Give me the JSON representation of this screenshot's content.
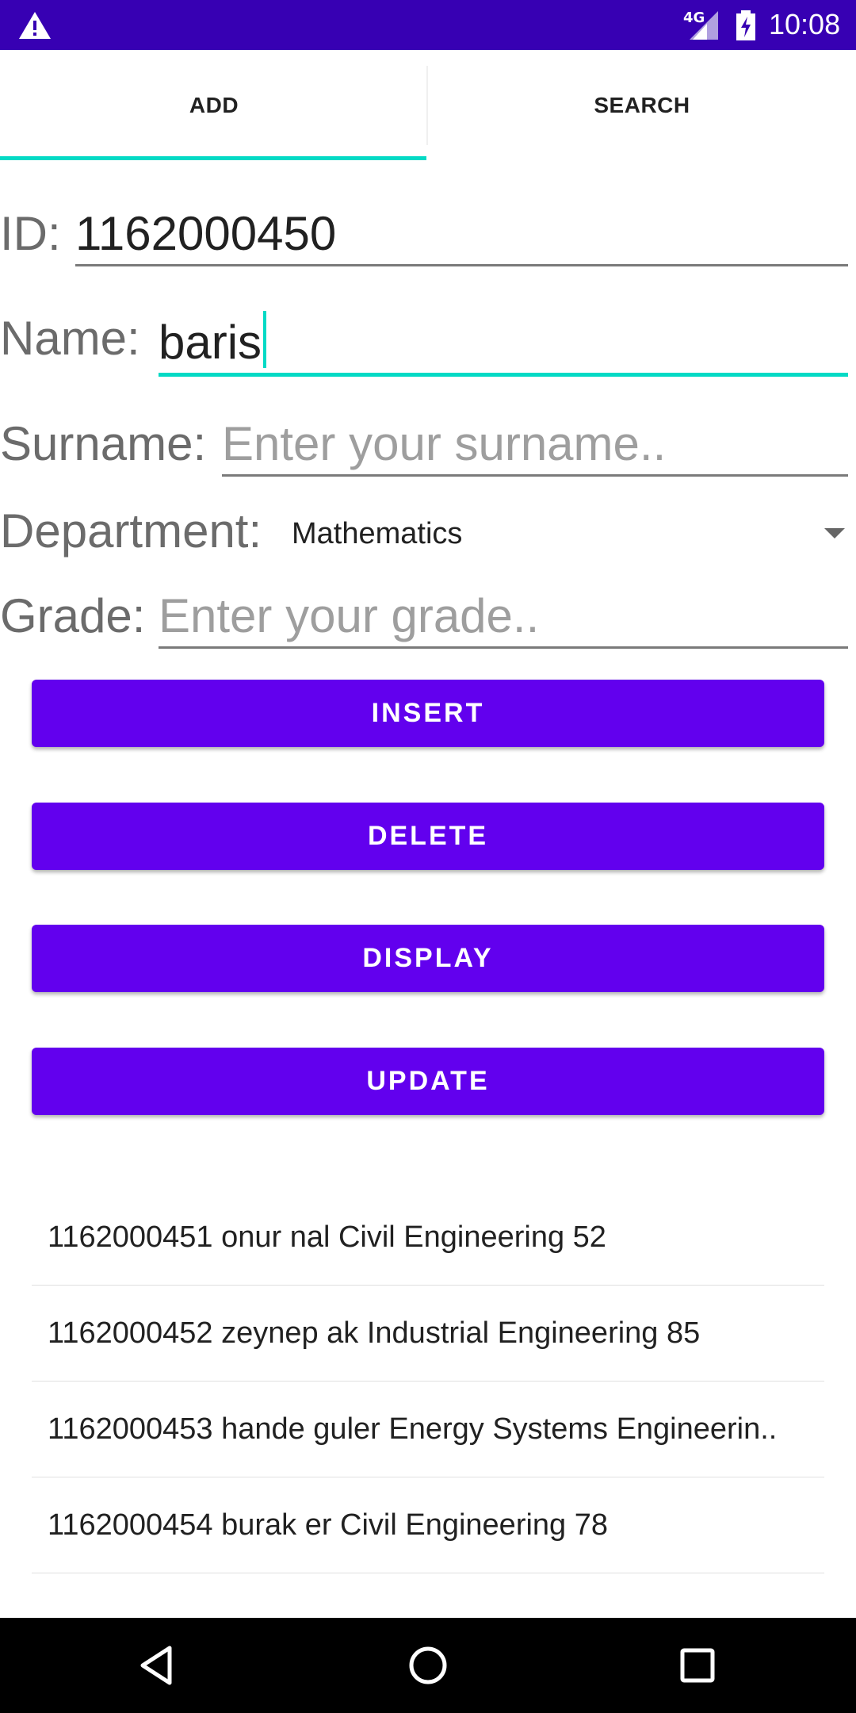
{
  "status_bar": {
    "time": "10:08",
    "network": "4G",
    "icons": [
      "warning-icon",
      "signal-icon",
      "battery-charging-icon"
    ]
  },
  "tabs": [
    {
      "label": "ADD",
      "selected": true
    },
    {
      "label": "SEARCH",
      "selected": false
    }
  ],
  "form": {
    "id_label": "ID:",
    "id_value": "1162000450",
    "name_label": "Name:",
    "name_value": "baris",
    "surname_label": "Surname:",
    "surname_placeholder": "Enter your surname..",
    "department_label": "Department:",
    "department_value": "Mathematics",
    "grade_label": "Grade:",
    "grade_placeholder": "Enter your grade.."
  },
  "buttons": {
    "insert": "INSERT",
    "delete": "DELETE",
    "display": "DISPLAY",
    "update": "UPDATE"
  },
  "records": [
    "1162000451 onur nal Civil Engineering 52",
    "1162000452 zeynep ak Industrial Engineering 85",
    "1162000453 hande guler Energy Systems Engineerin..",
    "1162000454 burak er Civil Engineering 78"
  ],
  "colors": {
    "status_bar": "#3700B3",
    "primary": "#6200EE",
    "accent": "#03DAC5"
  },
  "nav_bar": {
    "icons": [
      "back-icon",
      "home-icon",
      "recents-icon"
    ]
  }
}
